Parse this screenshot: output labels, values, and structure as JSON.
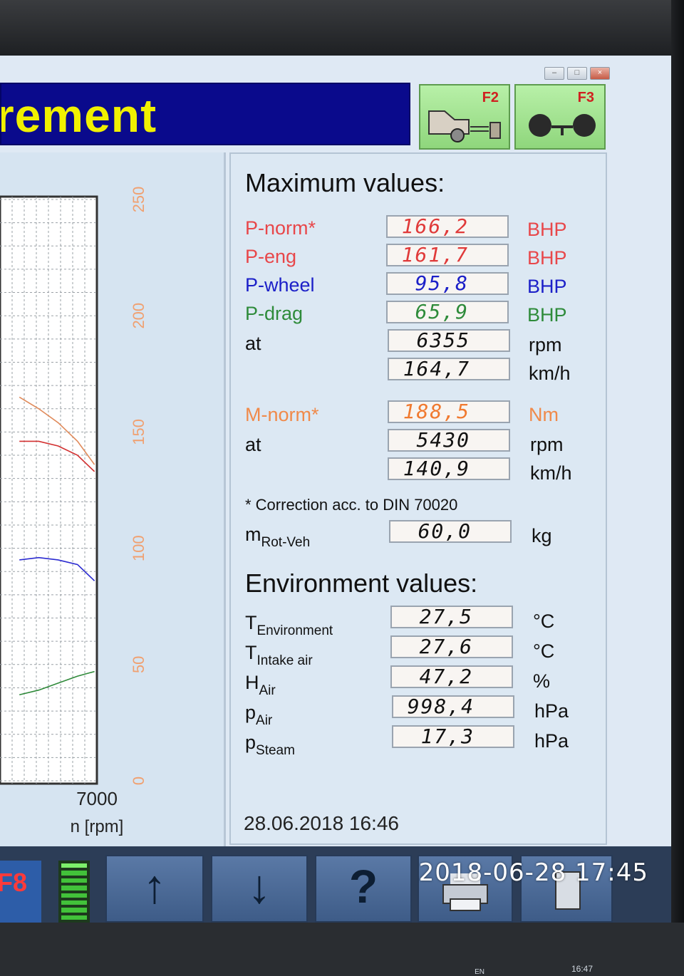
{
  "window": {
    "title": "rement",
    "controls": {
      "min": "–",
      "max": "□",
      "close": "×"
    }
  },
  "fkeys": {
    "f2": {
      "label": "F2",
      "icon": "car-on-dyno-icon"
    },
    "f3": {
      "label": "F3",
      "icon": "axle-wheels-icon"
    }
  },
  "chart": {
    "x_tick": "7000",
    "x_label": "n [rpm]",
    "y_ticks": [
      "250",
      "200",
      "150",
      "100",
      "50",
      "0"
    ]
  },
  "chart_data": {
    "type": "line",
    "xlabel": "n [rpm]",
    "ylabel": "",
    "y_ticks": [
      0,
      50,
      100,
      150,
      200,
      250
    ],
    "ylim": [
      0,
      250
    ],
    "x_visible_end": 7000,
    "grid": true,
    "series": [
      {
        "color": "#e08a5a",
        "x": [
          3800,
          4600,
          5400,
          6200,
          6900
        ],
        "y": [
          165,
          160,
          154,
          146,
          136
        ]
      },
      {
        "color": "#d23030",
        "x": [
          3800,
          4600,
          5400,
          6200,
          6900
        ],
        "y": [
          146,
          146,
          144,
          140,
          133
        ]
      },
      {
        "color": "#2a2ad0",
        "x": [
          3800,
          4600,
          5400,
          6200,
          6900
        ],
        "y": [
          95,
          96,
          95,
          93,
          86
        ]
      },
      {
        "color": "#2f8a3a",
        "x": [
          3800,
          4600,
          5400,
          6200,
          6900
        ],
        "y": [
          37,
          39,
          42,
          45,
          47
        ]
      }
    ]
  },
  "maximum": {
    "heading": "Maximum values:",
    "p_norm": {
      "label": "P-norm*",
      "value": "166,2",
      "unit": "BHP"
    },
    "p_eng": {
      "label": "P-eng",
      "value": "161,7",
      "unit": "BHP"
    },
    "p_wheel": {
      "label": "P-wheel",
      "value": "95,8",
      "unit": "BHP"
    },
    "p_drag": {
      "label": "P-drag",
      "value": "65,9",
      "unit": "BHP"
    },
    "p_at_rpm": {
      "label": "at",
      "value": "6355",
      "unit": "rpm"
    },
    "p_at_kmh": {
      "value": "164,7",
      "unit": "km/h"
    },
    "m_norm": {
      "label": "M-norm*",
      "value": "188,5",
      "unit": "Nm"
    },
    "m_at_rpm": {
      "label": "at",
      "value": "5430",
      "unit": "rpm"
    },
    "m_at_kmh": {
      "value": "140,9",
      "unit": "km/h"
    },
    "correction_note": "* Correction acc. to DIN 70020",
    "m_rot": {
      "label": "m",
      "sub": "Rot-Veh",
      "value": "60,0",
      "unit": "kg"
    }
  },
  "environment": {
    "heading": "Environment values:",
    "t_env": {
      "label": "T",
      "sub": "Environment",
      "value": "27,5",
      "unit": "°C"
    },
    "t_intake": {
      "label": "T",
      "sub": "Intake air",
      "value": "27,6",
      "unit": "°C"
    },
    "h_air": {
      "label": "H",
      "sub": "Air",
      "value": "47,2",
      "unit": "%"
    },
    "p_air": {
      "label": "p",
      "sub": "Air",
      "value": "998,4",
      "unit": "hPa"
    },
    "p_steam": {
      "label": "p",
      "sub": "Steam",
      "value": "17,3",
      "unit": "hPa"
    }
  },
  "timestamp": "28.06.2018  16:46",
  "taskbar": {
    "f8_label": "F8",
    "up_icon": "↑",
    "down_icon": "↓",
    "help_icon": "?"
  },
  "photo_watermark": "2018-06-28  17:45",
  "tray": {
    "clock": "16:47",
    "lang": "EN"
  },
  "colors": {
    "title_bg": "#0a0a8c",
    "title_text": "#f0f000",
    "p_norm": "#e8474a",
    "p_eng": "#e8474a",
    "p_wheel": "#1c20c8",
    "p_drag": "#2e8b3a",
    "m_norm": "#f08a4a"
  }
}
